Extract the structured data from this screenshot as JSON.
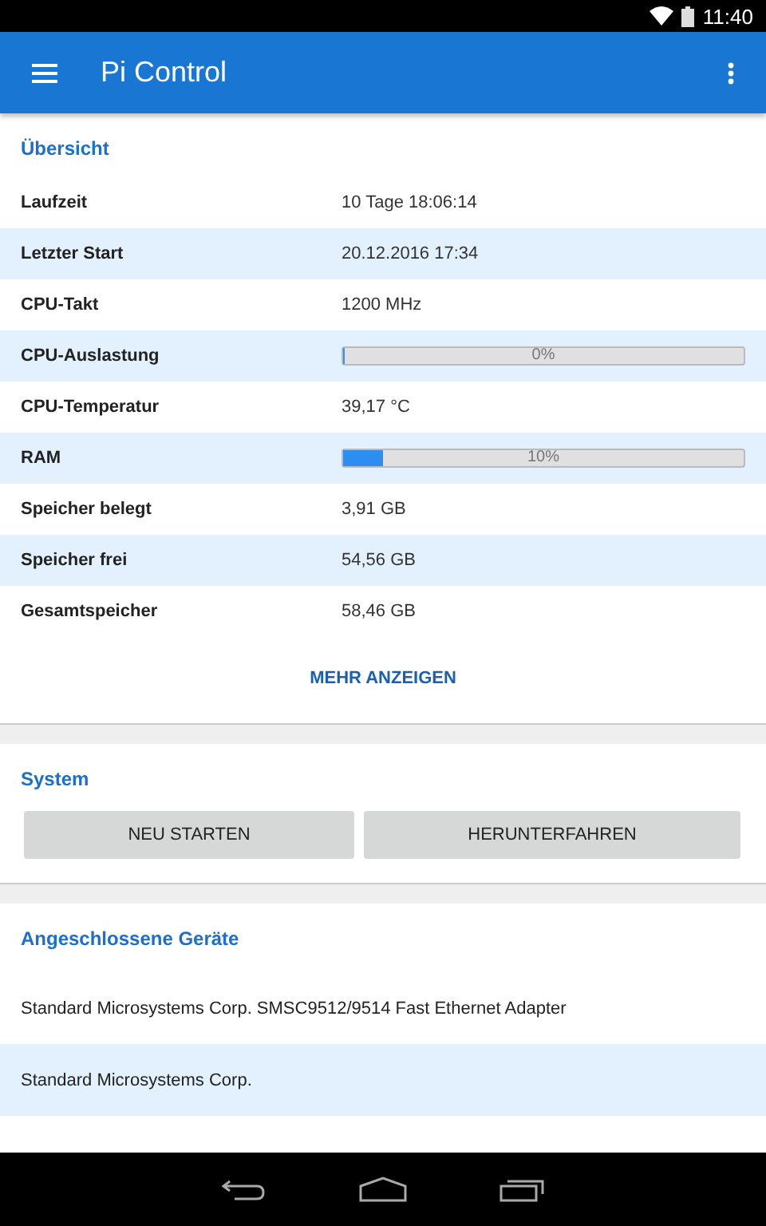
{
  "status_bar": {
    "time": "11:40"
  },
  "app_bar": {
    "title": "Pi Control"
  },
  "overview": {
    "title": "Übersicht",
    "rows": [
      {
        "label": "Laufzeit",
        "kind": "text",
        "value": "10 Tage 18:06:14"
      },
      {
        "label": "Letzter Start",
        "kind": "text",
        "value": "20.12.2016 17:34"
      },
      {
        "label": "CPU-Takt",
        "kind": "text",
        "value": "1200 MHz"
      },
      {
        "label": "CPU-Auslastung",
        "kind": "progress",
        "level": 0,
        "value": "0%"
      },
      {
        "label": "CPU-Temperatur",
        "kind": "text",
        "value": "39,17 °C"
      },
      {
        "label": "RAM",
        "kind": "progress",
        "level": 0.1,
        "value": "10%"
      },
      {
        "label": "Speicher belegt",
        "kind": "text",
        "value": "3,91 GB"
      },
      {
        "label": "Speicher frei",
        "kind": "text",
        "value": "54,56 GB"
      },
      {
        "label": "Gesamtspeicher",
        "kind": "text",
        "value": "58,46 GB"
      }
    ],
    "more_button": "MEHR ANZEIGEN"
  },
  "system": {
    "title": "System",
    "buttons": [
      "NEU STARTEN",
      "HERUNTERFAHREN"
    ]
  },
  "devices": {
    "title": "Angeschlossene Geräte",
    "items": [
      "Standard Microsystems Corp. SMSC9512/9514 Fast Ethernet Adapter",
      "Standard Microsystems Corp."
    ]
  }
}
